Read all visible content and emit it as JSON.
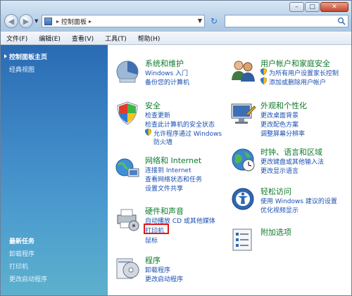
{
  "address": {
    "path": "控制面板"
  },
  "menu": [
    "文件(F)",
    "编辑(E)",
    "查看(V)",
    "工具(T)",
    "帮助(H)"
  ],
  "window_controls": {
    "minimize": "–",
    "maximize": "□",
    "close": "✕"
  },
  "left_pane": {
    "home": "控制面板主页",
    "classic": "经典视图",
    "recent_title": "最新任务",
    "recent": [
      "卸载程序",
      "打印机",
      "更改启动程序"
    ]
  },
  "categories": {
    "system": {
      "title": "系统和维护",
      "links": [
        "Windows 入门",
        "备份您的计算机"
      ]
    },
    "security": {
      "title": "安全",
      "links": [
        "检查更新",
        "检查此计算机的安全状态",
        "允许程序通过 Windows",
        "防火墙"
      ]
    },
    "network": {
      "title": "网络和 Internet",
      "links": [
        "连接到 Internet",
        "查看网络状态和任务",
        "设置文件共享"
      ]
    },
    "hardware": {
      "title": "硬件和声音",
      "links": [
        "自动播放 CD 或其他媒体",
        "打印机",
        "鼠标"
      ]
    },
    "programs": {
      "title": "程序",
      "links": [
        "卸载程序",
        "更改启动程序"
      ]
    },
    "users": {
      "title": "用户帐户和家庭安全",
      "links": [
        "为所有用户设置家长控制",
        "添加或删除用户帐户"
      ]
    },
    "appearance": {
      "title": "外观和个性化",
      "links": [
        "更改桌面背景",
        "更改配色方案",
        "调整屏幕分辨率"
      ]
    },
    "clock": {
      "title": "时钟、语言和区域",
      "links": [
        "更改键盘或其他输入法",
        "更改显示语言"
      ]
    },
    "ease": {
      "title": "轻松访问",
      "links": [
        "使用 Windows 建议的设置",
        "优化视频显示"
      ]
    },
    "extras": {
      "title": "附加选项",
      "links": []
    }
  },
  "colors": {
    "accent_green": "#0d7a2a",
    "link_blue": "#1a4fb0",
    "highlight_red": "#e11b1b"
  }
}
